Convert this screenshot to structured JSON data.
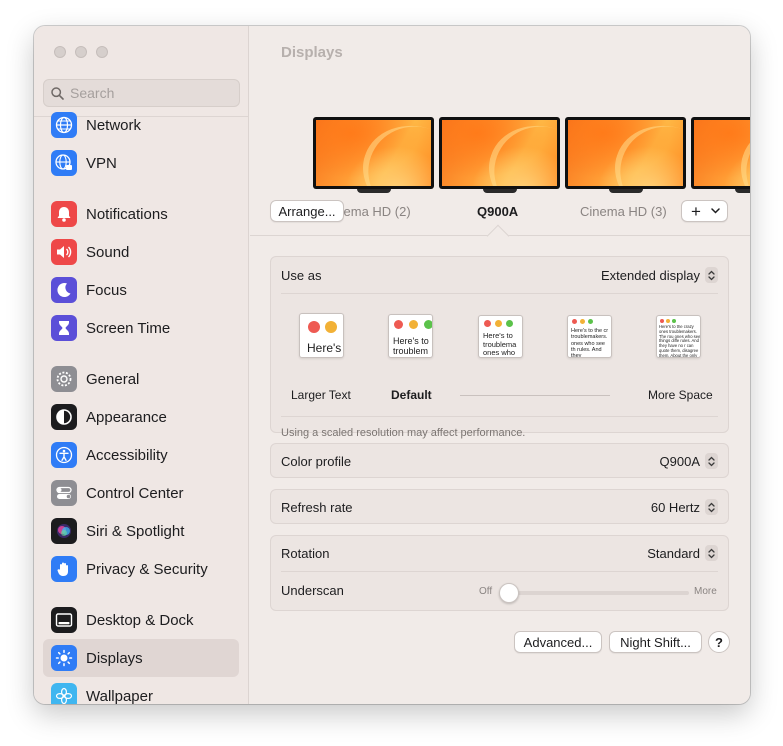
{
  "window": {
    "title": "Displays"
  },
  "search": {
    "placeholder": "Search"
  },
  "sidebar": {
    "items": [
      {
        "label": "Network",
        "icon": "globe-icon",
        "color": "#2f7cf6"
      },
      {
        "label": "VPN",
        "icon": "vpn-globe-icon",
        "color": "#2f7cf6"
      },
      {
        "label": "Notifications",
        "icon": "bell-icon",
        "color": "#ee4848"
      },
      {
        "label": "Sound",
        "icon": "speaker-icon",
        "color": "#ee4848"
      },
      {
        "label": "Focus",
        "icon": "moon-icon",
        "color": "#5b4fd8"
      },
      {
        "label": "Screen Time",
        "icon": "hourglass-icon",
        "color": "#5b4fd8"
      },
      {
        "label": "General",
        "icon": "gear-icon",
        "color": "#8e8e93"
      },
      {
        "label": "Appearance",
        "icon": "appearance-icon",
        "color": "#1c1c1e"
      },
      {
        "label": "Accessibility",
        "icon": "accessibility-icon",
        "color": "#2f7cf6"
      },
      {
        "label": "Control Center",
        "icon": "toggles-icon",
        "color": "#8e8e93"
      },
      {
        "label": "Siri & Spotlight",
        "icon": "siri-icon",
        "color": "#1c1c1e"
      },
      {
        "label": "Privacy & Security",
        "icon": "hand-icon",
        "color": "#2f7cf6"
      },
      {
        "label": "Desktop & Dock",
        "icon": "dock-icon",
        "color": "#1c1c1e"
      },
      {
        "label": "Displays",
        "icon": "sun-icon",
        "color": "#2f7cf6",
        "selected": true
      },
      {
        "label": "Wallpaper",
        "icon": "flower-icon",
        "color": "#3fb6f0"
      }
    ]
  },
  "displays": {
    "arrange_label": "Arrange...",
    "labels": [
      "Cinema HD (2)",
      "Q900A",
      "Cinema HD (3)"
    ],
    "selected": "Q900A",
    "add_label": "+"
  },
  "settings": {
    "use_as": {
      "label": "Use as",
      "value": "Extended display"
    },
    "resolution": {
      "options": [
        {
          "caption": "Larger Text",
          "sample": "Here's"
        },
        {
          "caption": "Default",
          "sample": "Here's to troublem",
          "selected": true
        },
        {
          "caption": "",
          "sample": "Here's to troublema ones who"
        },
        {
          "caption": "",
          "sample": "Here's to the cr troublemakers. ones who see th rules. And they"
        },
        {
          "caption": "More Space",
          "sample": "Here's to the crazy ones troublemakers. The rou ones who see things diffe rules. And they have no r can quote them, disagree them. About the only thin Because they change th"
        }
      ],
      "note": "Using a scaled resolution may affect performance."
    },
    "color_profile": {
      "label": "Color profile",
      "value": "Q900A"
    },
    "refresh_rate": {
      "label": "Refresh rate",
      "value": "60 Hertz"
    },
    "rotation": {
      "label": "Rotation",
      "value": "Standard"
    },
    "underscan": {
      "label": "Underscan",
      "min_label": "Off",
      "max_label": "More",
      "value": 0
    }
  },
  "footer": {
    "advanced_label": "Advanced...",
    "night_shift_label": "Night Shift...",
    "help_label": "?"
  }
}
